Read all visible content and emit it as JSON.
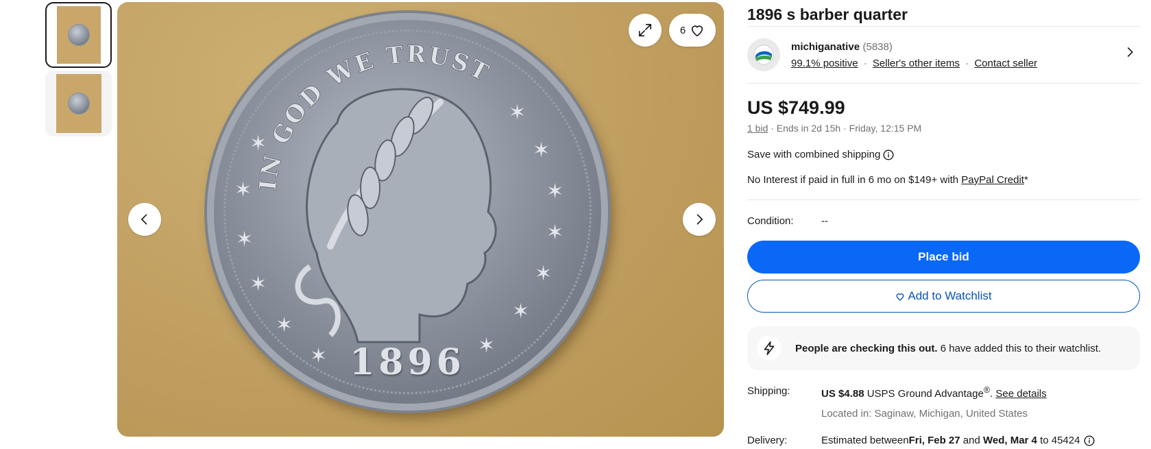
{
  "gallery": {
    "thumbnails": [
      {
        "alt": "coin obverse thumbnail",
        "active": true
      },
      {
        "alt": "coin reverse thumbnail",
        "active": false
      }
    ],
    "watch_count": "6",
    "coin_year": "1896",
    "coin_motto": "IN GOD WE TRUST"
  },
  "listing": {
    "title": "1896 s barber quarter"
  },
  "seller": {
    "name": "michiganative",
    "feedback_count": "(5838)",
    "positive": "99.1% positive",
    "other_items": "Seller's other items",
    "contact": "Contact seller",
    "separator": "·"
  },
  "pricing": {
    "price": "US $749.99",
    "bids": "1 bid",
    "ends": "· Ends in 2d 15h · Friday, 12:15 PM",
    "combined_shipping": "Save with combined shipping",
    "financing_prefix": "No Interest if paid in full in 6 mo on $149+ with ",
    "financing_link": "PayPal Credit",
    "financing_suffix": "*"
  },
  "condition": {
    "label": "Condition:",
    "value": "--"
  },
  "actions": {
    "place_bid": "Place bid",
    "add_watchlist": "Add to Watchlist"
  },
  "notice": {
    "bold": "People are checking this out.",
    "text": " 6 have added this to their watchlist."
  },
  "shipping": {
    "label": "Shipping:",
    "cost": "US $4.88",
    "service": " USPS Ground Advantage",
    "reg": "®",
    "period": ". ",
    "details_link": "See details",
    "location": "Located in: Saginaw, Michigan, United States"
  },
  "delivery": {
    "label": "Delivery:",
    "prefix": "Estimated between ",
    "start": "Fri, Feb 27",
    "and": " and ",
    "end": "Wed, Mar 4",
    "suffix": " to 45424"
  },
  "colors": {
    "primary_blue": "#0968f6",
    "link_blue": "#0654ba",
    "text": "#191919",
    "muted": "#707070"
  }
}
